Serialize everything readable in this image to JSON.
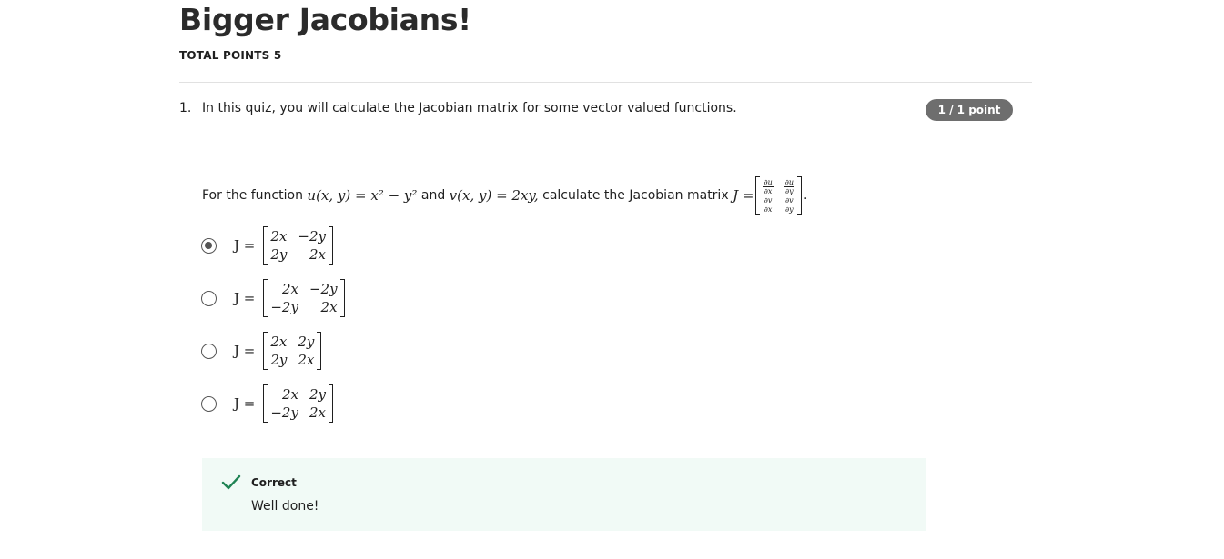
{
  "page": {
    "title": "Bigger Jacobians!",
    "total_points": "TOTAL POINTS 5"
  },
  "question": {
    "number": "1.",
    "intro": "In this quiz, you will calculate the Jacobian matrix for some vector valued functions.",
    "points_badge": "1 / 1 point",
    "prompt_prefix": "For the function",
    "u_def": "u(x, y) = x² − y²",
    "and_word": "and",
    "v_def": "v(x, y) = 2xy,",
    "prompt_middle": "calculate the Jacobian matrix",
    "jacobian_lhs": "J =",
    "jacobian_entries": [
      {
        "num": "∂u",
        "den": "∂x"
      },
      {
        "num": "∂u",
        "den": "∂y"
      },
      {
        "num": "∂v",
        "den": "∂x"
      },
      {
        "num": "∂v",
        "den": "∂y"
      }
    ],
    "prompt_end": "."
  },
  "options": [
    {
      "lhs": "J =",
      "matrix": [
        "2x",
        "−2y",
        "2y",
        "2x"
      ],
      "selected": true
    },
    {
      "lhs": "J =",
      "matrix": [
        "2x",
        "−2y",
        "−2y",
        "2x"
      ],
      "selected": false
    },
    {
      "lhs": "J =",
      "matrix": [
        "2x",
        "2y",
        "2y",
        "2x"
      ],
      "selected": false
    },
    {
      "lhs": "J =",
      "matrix": [
        "2x",
        "2y",
        "−2y",
        "2x"
      ],
      "selected": false
    }
  ],
  "feedback": {
    "status": "Correct",
    "message": "Well done!",
    "icon": "checkmark-icon",
    "color": "#1f8354",
    "background": "#f1faf6"
  }
}
